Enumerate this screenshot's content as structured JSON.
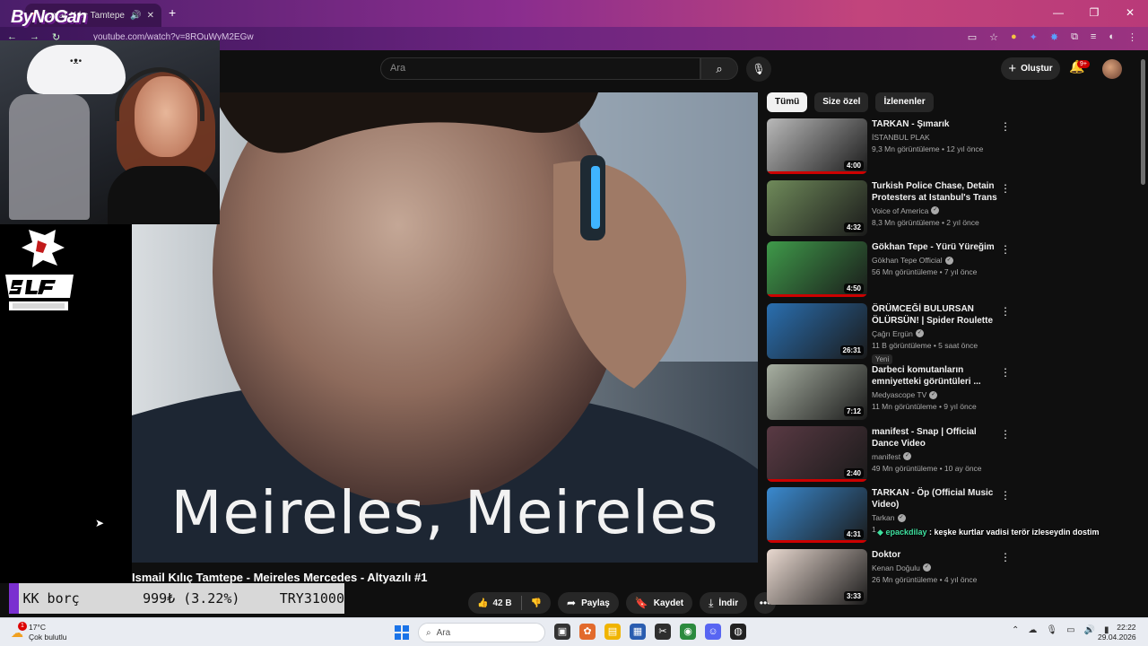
{
  "browser": {
    "tab_title": "Ismail Kılıç Tamtepe - M",
    "url": "youtube.com/watch?v=8ROuWyM2EGw",
    "new_tab": "+"
  },
  "overlay": {
    "streamer_logo": "ByNoGan",
    "team_logo_text": "SLF ESPORTS"
  },
  "youtube": {
    "search_placeholder": "Ara",
    "create_label": "Oluştur",
    "notification_count": "9+"
  },
  "video": {
    "subtitle": "Meireles, Meireles",
    "title": "Ismail Kılıç Tamtepe - Meireles Mercedes - Altyazılı #1",
    "like_count": "42 B",
    "share_label": "Paylaş",
    "save_label": "Kaydet",
    "download_label": "İndir"
  },
  "ticker": {
    "name": "KK borç",
    "value": "999₺ (3.22%)",
    "total": "TRY31000"
  },
  "chips": [
    {
      "label": "Tümü",
      "active": true
    },
    {
      "label": "Size özel",
      "active": false
    },
    {
      "label": "İzlenenler",
      "active": false
    }
  ],
  "recommendations": [
    {
      "title": "TARKAN - Şımarık",
      "channel": "İSTANBUL PLAK",
      "verified": false,
      "meta": "9,3 Mn görüntüleme • 12 yıl önce",
      "duration": "4:00",
      "badge": "",
      "progress": 1.0,
      "thumb_color": "#b9b9b9"
    },
    {
      "title": "Turkish Police Chase, Detain Protesters at Istanbul's Trans ...",
      "channel": "Voice of America",
      "verified": true,
      "meta": "8,3 Mn görüntüleme • 2 yıl önce",
      "duration": "4:32",
      "badge": "",
      "progress": 0.0,
      "thumb_color": "#6f8a5a"
    },
    {
      "title": "Gökhan Tepe - Yürü Yüreğim",
      "channel": "Gökhan Tepe Official",
      "verified": true,
      "meta": "56 Mn görüntüleme • 7 yıl önce",
      "duration": "4:50",
      "badge": "",
      "progress": 1.0,
      "thumb_color": "#3f9a4a"
    },
    {
      "title": "ÖRÜMCEĞİ BULURSAN ÖLÜRSÜN! | Spider Roulette",
      "channel": "Çağrı Ergün",
      "verified": true,
      "meta": "11 B görüntüleme • 5 saat önce",
      "duration": "26:31",
      "badge": "Yeni",
      "progress": 0.0,
      "thumb_color": "#2a6fb0"
    },
    {
      "title": "Darbeci komutanların emniyetteki görüntüleri ...",
      "channel": "Medyascope TV",
      "verified": true,
      "meta": "11 Mn görüntüleme • 9 yıl önce",
      "duration": "7:12",
      "badge": "",
      "progress": 0.0,
      "thumb_color": "#a8b0a2"
    },
    {
      "title": "manifest - Snap | Official Dance Video",
      "channel": "manifest",
      "verified": true,
      "meta": "49 Mn görüntüleme • 10 ay önce",
      "duration": "2:40",
      "badge": "",
      "progress": 1.0,
      "thumb_color": "#5a3a44"
    },
    {
      "title": "TARKAN - Öp (Official Music Video)",
      "channel": "Tarkan",
      "verified": true,
      "meta": "1",
      "duration": "4:31",
      "badge": "",
      "progress": 1.0,
      "thumb_color": "#3a8ad0"
    },
    {
      "title": "Doktor",
      "channel": "Kenan Doğulu",
      "verified": true,
      "meta": "26 Mn görüntüleme • 4 yıl önce",
      "duration": "3:33",
      "badge": "",
      "progress": 0.0,
      "thumb_color": "#e9d9d0"
    }
  ],
  "chat": {
    "user": "epackdilay",
    "message": ": keşke kurtlar vadisi terör izleseydin dostim"
  },
  "taskbar": {
    "temperature": "17°C",
    "weather": "Çok bulutlu",
    "weather_badge": "1",
    "search_placeholder": "Ara",
    "time": "22:22",
    "date": "29.04.2026"
  }
}
